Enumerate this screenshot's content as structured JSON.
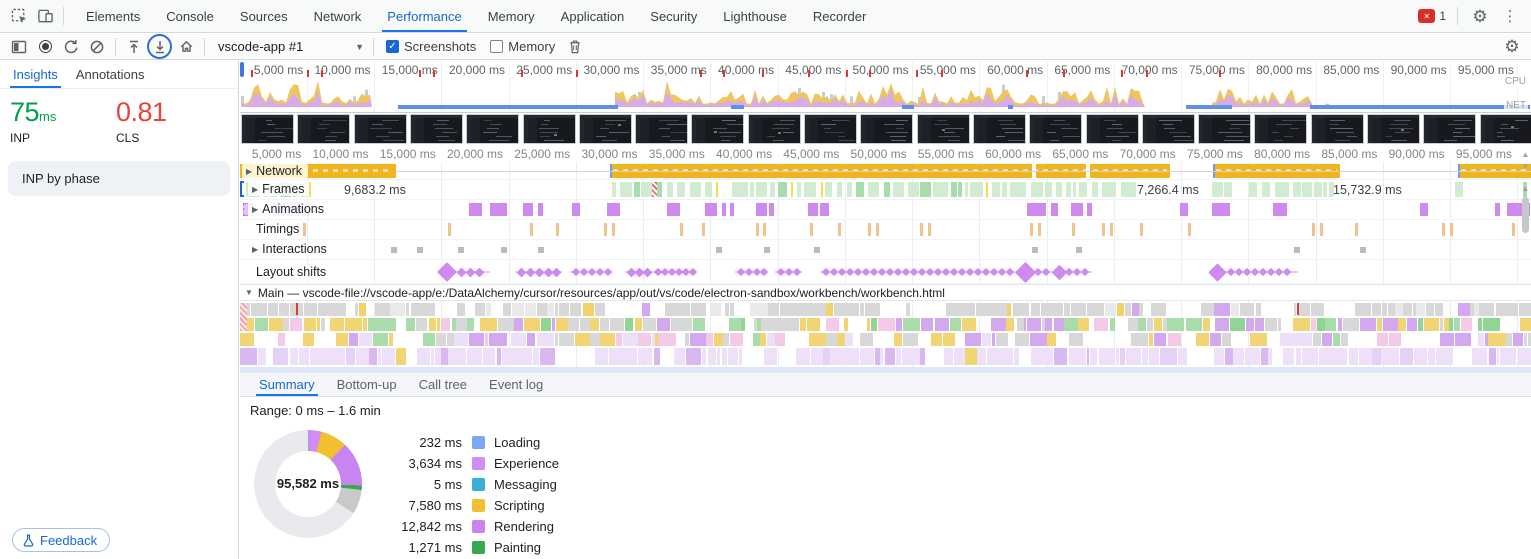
{
  "top_bar": {
    "tabs": [
      "Elements",
      "Console",
      "Sources",
      "Network",
      "Performance",
      "Memory",
      "Application",
      "Security",
      "Lighthouse",
      "Recorder"
    ],
    "active_tab": "Performance",
    "error_count": "1"
  },
  "perf_toolbar": {
    "target_select": "vscode-app #1",
    "screenshots_label": "Screenshots",
    "memory_label": "Memory",
    "screenshots_checked": true,
    "memory_checked": false
  },
  "sidebar": {
    "tabs": [
      "Insights",
      "Annotations"
    ],
    "active_tab": "Insights",
    "metrics": [
      {
        "value": "75",
        "unit": "ms",
        "label": "INP",
        "color": "#00a04c"
      },
      {
        "value": "0.81",
        "unit": "",
        "label": "CLS",
        "color": "#e8443a"
      }
    ],
    "insights": [
      "INP by phase"
    ],
    "feedback_label": "Feedback"
  },
  "timeline": {
    "ruler_labels": [
      "5,000 ms",
      "10,000 ms",
      "15,000 ms",
      "20,000 ms",
      "25,000 ms",
      "30,000 ms",
      "35,000 ms",
      "40,000 ms",
      "45,000 ms",
      "50,000 ms",
      "55,000 ms",
      "60,000 ms",
      "65,000 ms",
      "70,000 ms",
      "75,000 ms",
      "80,000 ms",
      "85,000 ms",
      "90,000 ms",
      "95,000 ms"
    ],
    "cpu_label": "CPU",
    "net_label": "NET",
    "tracks": {
      "network": "Network",
      "frames": "Frames",
      "animations": "Animations",
      "timings": "Timings",
      "interactions": "Interactions",
      "layout_shifts": "Layout shifts"
    },
    "frame_durations": [
      "9,683.2 ms",
      "7,266.4 ms",
      "15,732.9 ms"
    ],
    "main_track_label": "Main — vscode-file://vscode-app/e:/DataAlchemy/cursor/resources/app/out/vs/code/electron-sandbox/workbench/workbench.html"
  },
  "bottom_panel": {
    "tabs": [
      "Summary",
      "Bottom-up",
      "Call tree",
      "Event log"
    ],
    "active_tab": "Summary",
    "range_label": "Range: 0 ms – 1.6 min"
  },
  "chart_data": {
    "type": "pie",
    "title": "Range: 0 ms – 1.6 min",
    "center_label": "95,582 ms",
    "units": "ms",
    "segments": [
      {
        "label": "Loading",
        "value": 232,
        "display": "232 ms",
        "color": "#7da7f4"
      },
      {
        "label": "Experience",
        "value": 3634,
        "display": "3,634 ms",
        "color": "#d18cf5"
      },
      {
        "label": "Messaging",
        "value": 5,
        "display": "5 ms",
        "color": "#36b0d6"
      },
      {
        "label": "Scripting",
        "value": 7580,
        "display": "7,580 ms",
        "color": "#f0c02f"
      },
      {
        "label": "Rendering",
        "value": 12842,
        "display": "12,842 ms",
        "color": "#c885f2"
      },
      {
        "label": "Painting",
        "value": 1271,
        "display": "1,271 ms",
        "color": "#36a850"
      }
    ],
    "legend_position": "right"
  }
}
